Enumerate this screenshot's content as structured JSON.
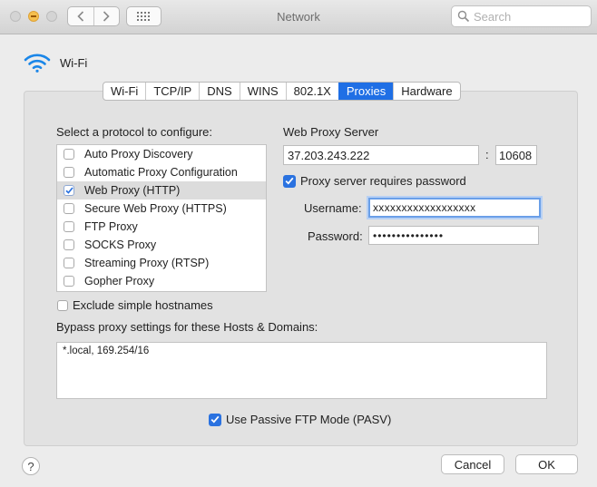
{
  "window": {
    "title": "Network",
    "search_placeholder": "Search"
  },
  "interface": {
    "name": "Wi-Fi",
    "icon": "wifi-icon"
  },
  "tabs": [
    {
      "label": "Wi-Fi",
      "active": false
    },
    {
      "label": "TCP/IP",
      "active": false
    },
    {
      "label": "DNS",
      "active": false
    },
    {
      "label": "WINS",
      "active": false
    },
    {
      "label": "802.1X",
      "active": false
    },
    {
      "label": "Proxies",
      "active": true
    },
    {
      "label": "Hardware",
      "active": false
    }
  ],
  "protocols": {
    "heading": "Select a protocol to configure:",
    "items": [
      {
        "label": "Auto Proxy Discovery",
        "checked": false
      },
      {
        "label": "Automatic Proxy Configuration",
        "checked": false
      },
      {
        "label": "Web Proxy (HTTP)",
        "checked": true
      },
      {
        "label": "Secure Web Proxy (HTTPS)",
        "checked": false
      },
      {
        "label": "FTP Proxy",
        "checked": false
      },
      {
        "label": "SOCKS Proxy",
        "checked": false
      },
      {
        "label": "Streaming Proxy (RTSP)",
        "checked": false
      },
      {
        "label": "Gopher Proxy",
        "checked": false
      }
    ]
  },
  "exclude_simple": {
    "label": "Exclude simple hostnames",
    "checked": false
  },
  "bypass": {
    "label": "Bypass proxy settings for these Hosts & Domains:",
    "value": "*.local, 169.254/16"
  },
  "pasv": {
    "label": "Use Passive FTP Mode (PASV)",
    "checked": true
  },
  "server": {
    "label": "Web Proxy Server",
    "host": "37.203.243.222",
    "colon": ":",
    "port": "10608",
    "requires_password_label": "Proxy server requires password",
    "requires_password": true,
    "username_label": "Username:",
    "username": "xxxxxxxxxxxxxxxxxx",
    "password_label": "Password:",
    "password": "•••••••••••••••"
  },
  "footer": {
    "help": "?",
    "cancel": "Cancel",
    "ok": "OK"
  },
  "colors": {
    "accent": "#1f6fe5",
    "wifi": "#1a86e8"
  }
}
